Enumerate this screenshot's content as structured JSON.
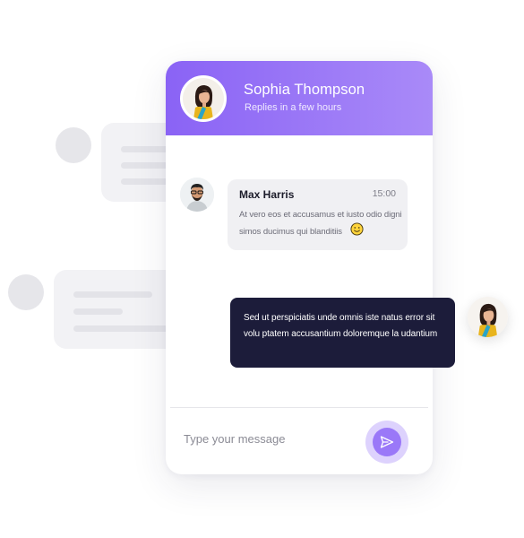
{
  "header": {
    "name": "Sophia Thompson",
    "status": "Replies in a few hours"
  },
  "incoming": {
    "sender": "Max Harris",
    "time": "15:00",
    "text": "At vero eos et accusamus et iusto odio digni simos ducimus qui blanditiis",
    "emoji_icon": "smiley-face-icon"
  },
  "outgoing": {
    "text": "Sed ut perspiciatis unde omnis iste natus error sit volu ptatem accusantium doloremque la udantium"
  },
  "composer": {
    "placeholder": "Type your message",
    "send_icon": "send-icon"
  },
  "colors": {
    "header_gradient_start": "#8a63f5",
    "header_gradient_end": "#a98af8",
    "outgoing_bubble": "#1c1c3a",
    "incoming_bubble": "#f0f0f3",
    "send_button": "#9a78f8"
  }
}
